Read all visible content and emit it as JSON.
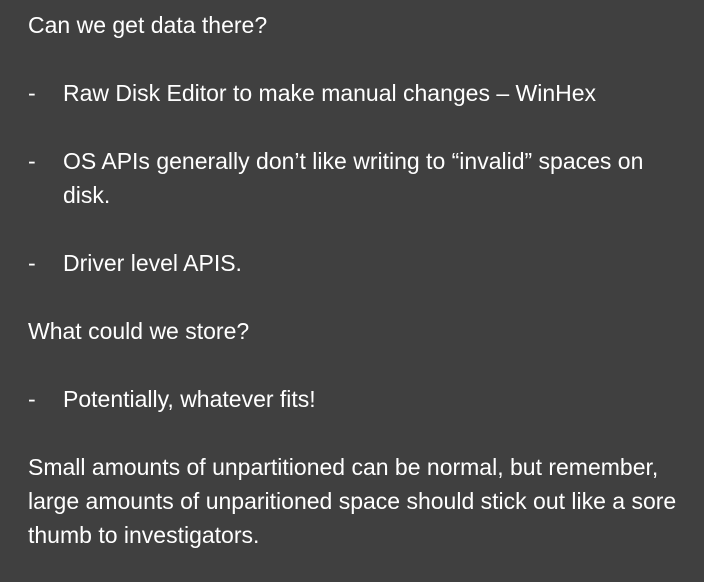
{
  "sections": {
    "q1": "Can we get data there?",
    "q1_bullets": [
      "Raw Disk Editor to make manual changes – WinHex",
      "OS APIs generally don’t like writing to “invalid” spaces on disk.",
      "Driver level APIS."
    ],
    "q2": "What could we store?",
    "q2_bullets": [
      "Potentially, whatever fits!"
    ],
    "closing": "Small amounts of unpartitioned can be normal, but remember, large amounts of unparitioned space should stick out like a sore thumb to investigators."
  },
  "bullet_marker": "-",
  "colors": {
    "background": "#404040",
    "text": "#ffffff"
  }
}
